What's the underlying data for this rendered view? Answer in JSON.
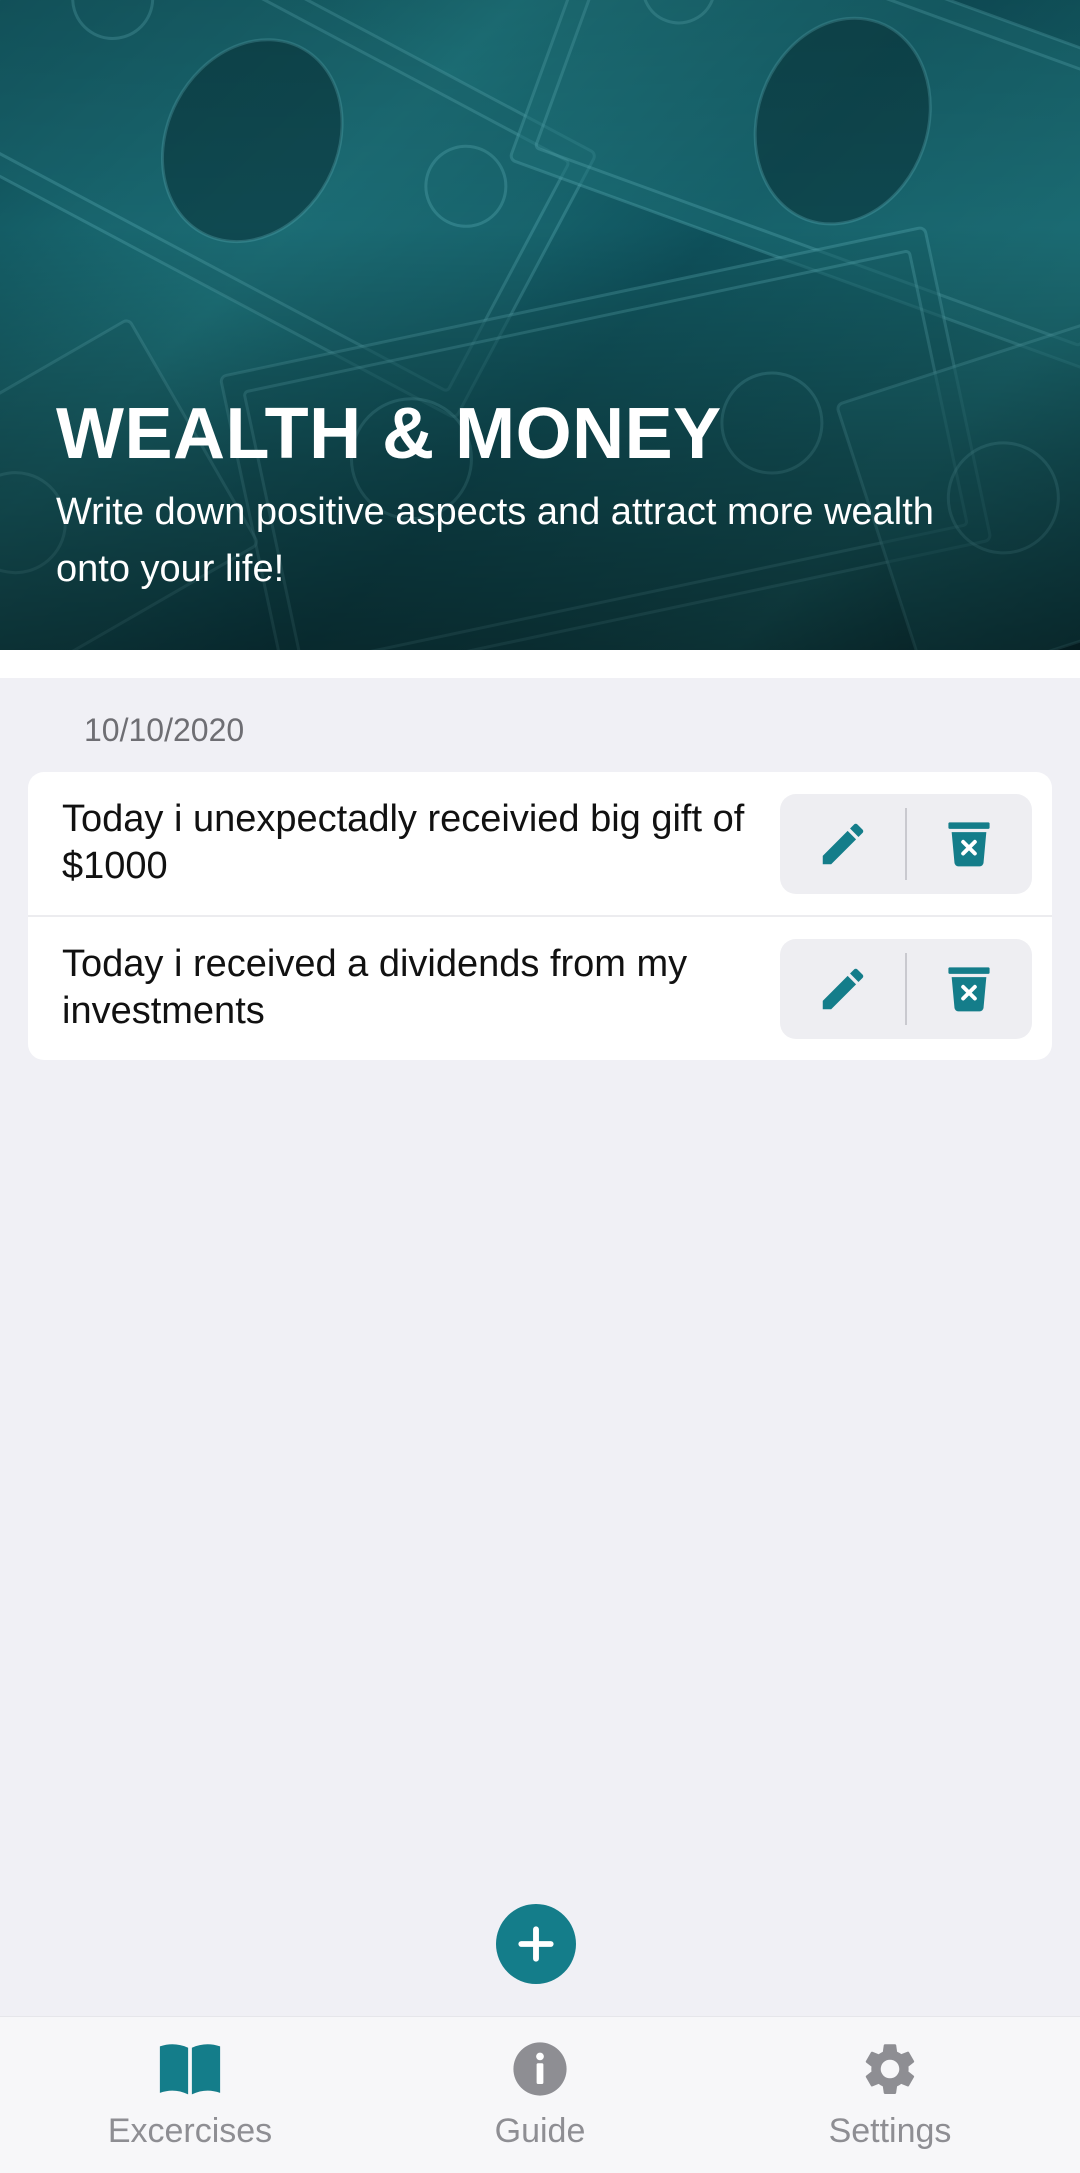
{
  "header": {
    "title": "WEALTH & MONEY",
    "subtitle": "Write down positive aspects and attract more wealth onto your life!",
    "background_image": "dollar-bills-banner"
  },
  "journal": {
    "date": "10/10/2020",
    "entries": [
      {
        "text": "Today i unexpectadly receivied big gift of $1000",
        "edit_icon": "pencil-icon",
        "delete_icon": "trash-icon"
      },
      {
        "text": "Today i received a dividends from my investments",
        "edit_icon": "pencil-icon",
        "delete_icon": "trash-icon"
      }
    ]
  },
  "fab": {
    "icon": "plus-icon"
  },
  "bottom_nav": {
    "items": [
      {
        "label": "Excercises",
        "icon": "book-icon",
        "active": true
      },
      {
        "label": "Guide",
        "icon": "info-icon",
        "active": false
      },
      {
        "label": "Settings",
        "icon": "gear-icon",
        "active": false
      }
    ]
  },
  "colors": {
    "accent": "#147d8a",
    "inactive": "#8e8e93",
    "background": "#f0f0f5",
    "card": "#ffffff"
  }
}
